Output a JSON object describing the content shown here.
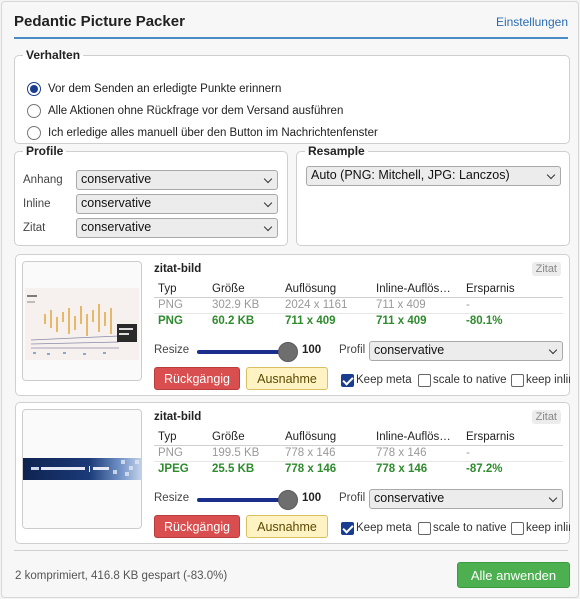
{
  "app": {
    "title": "Pedantic Picture Packer",
    "settings_link": "Einstellungen"
  },
  "behavior": {
    "legend": "Verhalten",
    "options": [
      {
        "label": "Vor dem Senden an erledigte Punkte erinnern",
        "checked": true
      },
      {
        "label": "Alle Aktionen ohne Rückfrage vor dem Versand ausführen",
        "checked": false
      },
      {
        "label": "Ich erledige alles manuell über den Button im Nachrichtenfenster",
        "checked": false
      }
    ]
  },
  "profiles": {
    "legend": "Profile",
    "rows": [
      {
        "label": "Anhang",
        "value": "conservative"
      },
      {
        "label": "Inline",
        "value": "conservative"
      },
      {
        "label": "Zitat",
        "value": "conservative"
      }
    ]
  },
  "resample": {
    "legend": "Resample",
    "value": "Auto (PNG: Mitchell, JPG: Lanczos)"
  },
  "columns": {
    "type": "Typ",
    "size": "Größe",
    "resolution": "Auflösung",
    "inline_res": "Inline-Auflös…",
    "savings": "Ersparnis"
  },
  "images": [
    {
      "name": "zitat-bild",
      "tag": "Zitat",
      "orig": {
        "type": "PNG",
        "size": "302.9 KB",
        "resolution": "2024 x 1161",
        "inline_res": "711 x 409",
        "savings": "-"
      },
      "new": {
        "type": "PNG",
        "size": "60.2 KB",
        "resolution": "711 x 409",
        "inline_res": "711 x 409",
        "savings": "-80.1%"
      },
      "resize_label": "Resize",
      "resize_value": "100",
      "profile_label": "Profil",
      "profile_value": "conservative",
      "undo_label": "Rückgängig",
      "exception_label": "Ausnahme",
      "keep_meta": {
        "label": "Keep meta",
        "checked": true
      },
      "scale_native": {
        "label": "scale to native",
        "checked": false
      },
      "keep_inline": {
        "label": "keep inline",
        "checked": false
      }
    },
    {
      "name": "zitat-bild",
      "tag": "Zitat",
      "orig": {
        "type": "PNG",
        "size": "199.5 KB",
        "resolution": "778 x 146",
        "inline_res": "778 x 146",
        "savings": "-"
      },
      "new": {
        "type": "JPEG",
        "size": "25.5 KB",
        "resolution": "778 x 146",
        "inline_res": "778 x 146",
        "savings": "-87.2%"
      },
      "resize_label": "Resize",
      "resize_value": "100",
      "profile_label": "Profil",
      "profile_value": "conservative",
      "undo_label": "Rückgängig",
      "exception_label": "Ausnahme",
      "keep_meta": {
        "label": "Keep meta",
        "checked": true
      },
      "scale_native": {
        "label": "scale to native",
        "checked": false
      },
      "keep_inline": {
        "label": "keep inline",
        "checked": false
      }
    }
  ],
  "footer": {
    "status": "2 komprimiert, 416.8 KB gespart (-83.0%)",
    "apply_label": "Alle anwenden"
  },
  "colors": {
    "accent": "#4a8cc8",
    "green": "#2e8b2e",
    "danger": "#d94f4f",
    "apply": "#4caf50"
  }
}
